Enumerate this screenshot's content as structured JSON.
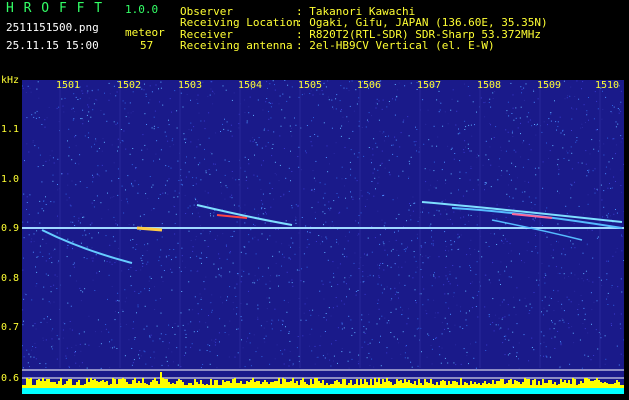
{
  "app": {
    "title": "H R O F F T",
    "version": "1.0.0",
    "filename": "2511151500.png",
    "datetime": "25.11.15 15:00",
    "meteor_label": "meteor",
    "meteor_count": "57"
  },
  "info": {
    "labels": [
      "Observer",
      "Receiving Location",
      "Receiver",
      "Receiving antenna"
    ],
    "values": [
      ": Takanori Kawachi",
      ": Ogaki, Gifu, JAPAN (136.60E, 35.35N)",
      ": R820T2(RTL-SDR) SDR-Sharp 53.372MHz",
      ": 2el-HB9CV Vertical (el. E-W)"
    ]
  },
  "y_axis": {
    "unit": "kHz",
    "ticks": [
      "1.1",
      "1.0",
      "0.9",
      "0.8",
      "0.7",
      "0.6"
    ]
  },
  "x_axis": {
    "ticks": [
      "1501",
      "1502",
      "1503",
      "1504",
      "1505",
      "1506",
      "1507",
      "1508",
      "1509",
      "1510"
    ]
  },
  "colors": {
    "background": "#1a1a8a",
    "carrier": "#9fd8ff",
    "header_green": "#33ff66",
    "header_yellow": "#ffff33",
    "bottom_bar": "#00ffff",
    "level_bars": "#ffff00"
  }
}
